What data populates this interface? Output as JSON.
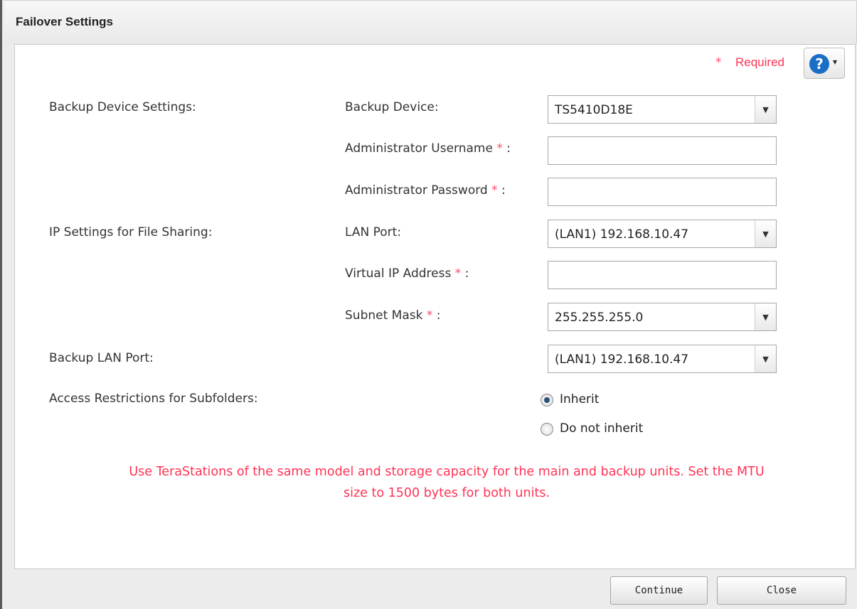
{
  "dialog": {
    "title": "Failover Settings"
  },
  "required": {
    "star": "*",
    "label": "Required"
  },
  "help": {
    "icon": "?",
    "caret": "▾"
  },
  "sections": {
    "backup_device_settings": "Backup Device Settings:",
    "ip_settings": "IP Settings for File Sharing:",
    "backup_lan_port": "Backup LAN Port:",
    "access_restrictions": "Access Restrictions for Subfolders:"
  },
  "fields": {
    "backup_device": {
      "label": "Backup Device:",
      "value": "TS5410D18E"
    },
    "admin_username": {
      "label": "Administrator Username",
      "suffix": " :",
      "value": ""
    },
    "admin_password": {
      "label": "Administrator Password",
      "suffix": " :",
      "value": ""
    },
    "lan_port": {
      "label": "LAN Port:",
      "value": "(LAN1) 192.168.10.47"
    },
    "virtual_ip": {
      "label": "Virtual IP Address",
      "suffix": " :",
      "value": ""
    },
    "subnet_mask": {
      "label": "Subnet Mask",
      "suffix": " :",
      "value": "255.255.255.0"
    },
    "backup_lan_port": {
      "value": "(LAN1) 192.168.10.47"
    }
  },
  "required_marker": "*",
  "access_options": [
    {
      "label": "Inherit",
      "checked": true
    },
    {
      "label": "Do not inherit",
      "checked": false
    }
  ],
  "notice": {
    "line1": "Use TeraStations of the same model and storage capacity for the main and backup units. Set the MTU",
    "line2": "size to 1500 bytes for both units."
  },
  "buttons": {
    "continue": "Continue",
    "close": "Close"
  },
  "colors": {
    "required_red": "#ff3355",
    "help_blue": "#1a6ec8"
  }
}
